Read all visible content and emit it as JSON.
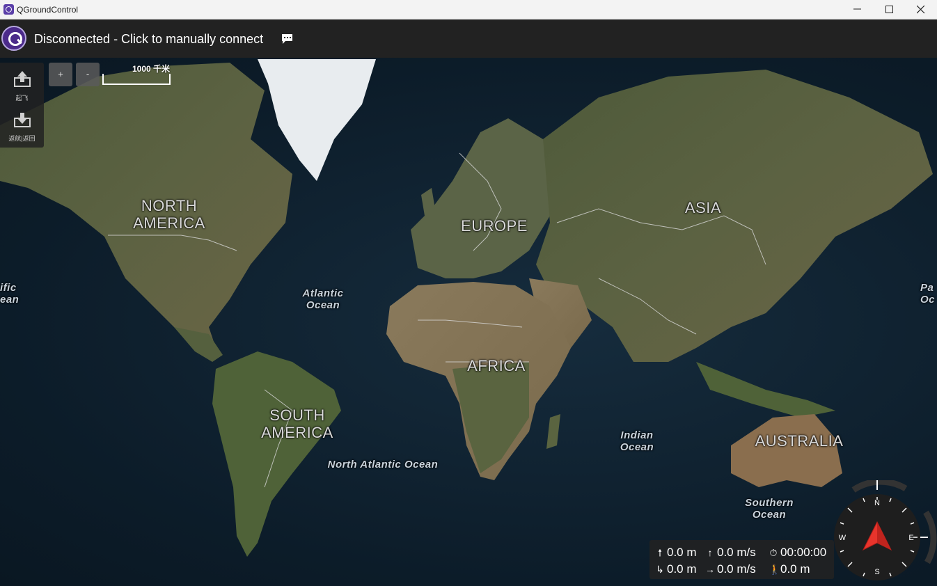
{
  "window": {
    "title": "QGroundControl",
    "controls": {
      "minimize": "minimize-icon",
      "maximize": "maximize-icon",
      "close": "close-icon"
    }
  },
  "toolbar": {
    "connection_status": "Disconnected - Click to manually connect",
    "chat_icon": "chat-bubble-icon"
  },
  "tools": [
    {
      "label": "起飞",
      "icon": "takeoff-icon"
    },
    {
      "label": "返航|返回",
      "icon": "return-icon"
    }
  ],
  "zoom": {
    "in_label": "+",
    "out_label": "-"
  },
  "scale": {
    "label": "1000 千米"
  },
  "map_labels": {
    "north_america": "NORTH\nAMERICA",
    "south_america": "SOUTH\nAMERICA",
    "europe": "EUROPE",
    "asia": "ASIA",
    "africa": "AFRICA",
    "australia": "AUSTRALIA",
    "atlantic_ocean": "Atlantic\nOcean",
    "north_atlantic_ocean": "North Atlantic Ocean",
    "indian_ocean": "Indian\nOcean",
    "southern_ocean": "Southern\nOcean",
    "pacific_left": "ific\nean",
    "pacific_right": "Pa\nOc"
  },
  "telemetry": {
    "altitude": "0.0 m",
    "vertical_speed": "0.0 m/s",
    "flight_time": "00:00:00",
    "distance": "0.0 m",
    "ground_speed": "0.0 m/s",
    "home_distance": "0.0 m"
  },
  "compass": {
    "n": "N",
    "e": "E",
    "s": "S",
    "w": "W",
    "heading_color": "#e8342c"
  }
}
